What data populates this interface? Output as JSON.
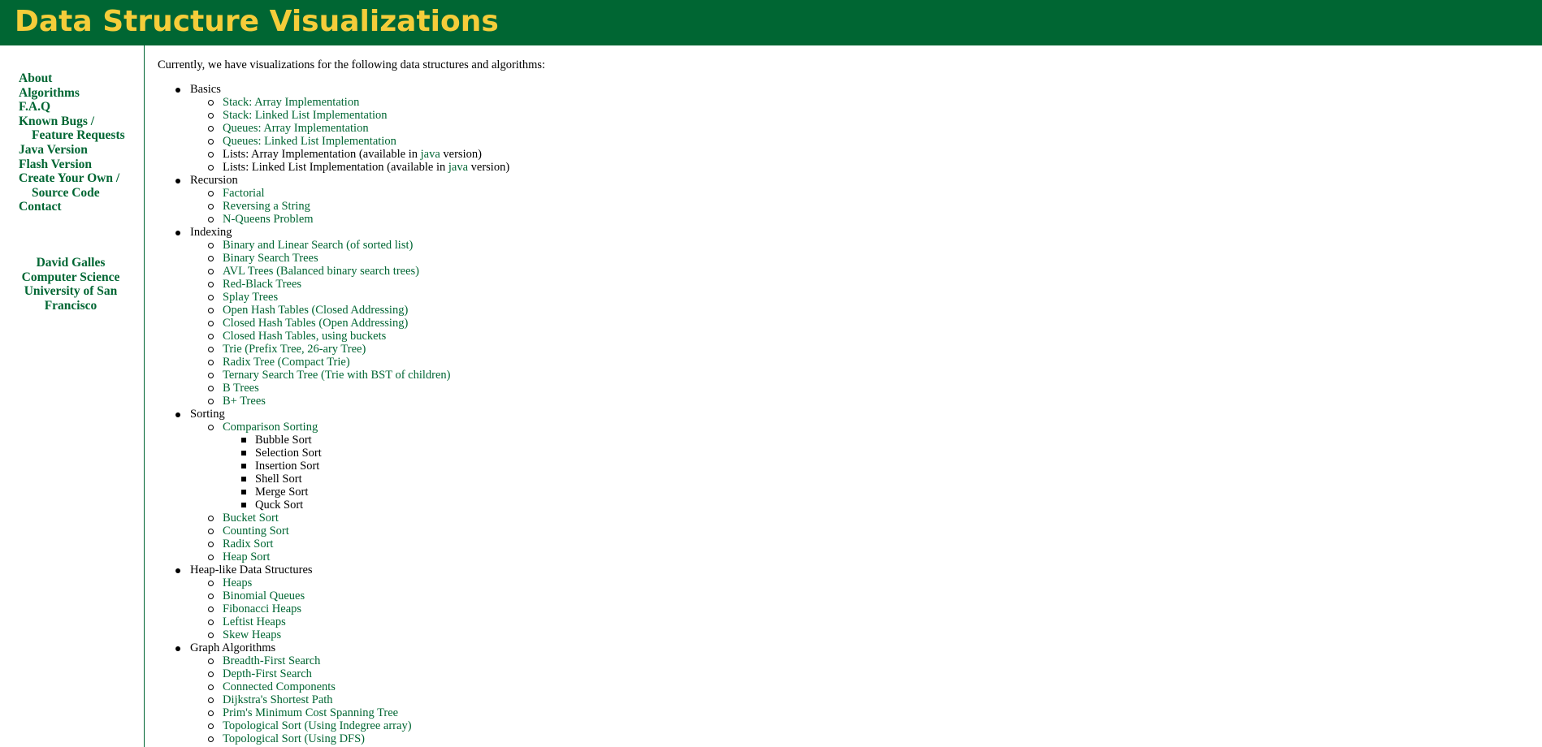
{
  "header": {
    "title": "Data Structure Visualizations"
  },
  "sidebar": {
    "links": [
      {
        "line1": "About",
        "line2": ""
      },
      {
        "line1": "Algorithms",
        "line2": ""
      },
      {
        "line1": "F.A.Q",
        "line2": ""
      },
      {
        "line1": "Known Bugs /",
        "line2": "Feature Requests"
      },
      {
        "line1": "Java Version",
        "line2": ""
      },
      {
        "line1": "Flash Version",
        "line2": ""
      },
      {
        "line1": "Create Your Own /",
        "line2": "Source Code"
      },
      {
        "line1": "Contact",
        "line2": ""
      }
    ],
    "author": {
      "name": "David Galles",
      "dept": "Computer Science",
      "univ_line1": "University of San",
      "univ_line2": "Francisco"
    }
  },
  "content": {
    "intro": "Currently, we have visualizations for the following data structures and algorithms:",
    "sections": [
      {
        "title": "Basics",
        "items": [
          {
            "label": "Stack: Array Implementation"
          },
          {
            "label": "Stack: Linked List Implementation"
          },
          {
            "label": "Queues: Array Implementation"
          },
          {
            "label": "Queues: Linked List Implementation"
          },
          {
            "prefix": "Lists: Array Implementation (available in ",
            "link": "java",
            "suffix": " version)"
          },
          {
            "prefix": "Lists: Linked List Implementation (available in ",
            "link": "java",
            "suffix": " version)"
          }
        ]
      },
      {
        "title": "Recursion",
        "items": [
          {
            "label": "Factorial"
          },
          {
            "label": "Reversing a String"
          },
          {
            "label": "N-Queens Problem"
          }
        ]
      },
      {
        "title": "Indexing",
        "items": [
          {
            "label": "Binary and Linear Search (of sorted list)"
          },
          {
            "label": "Binary Search Trees"
          },
          {
            "label": "AVL Trees (Balanced binary search trees)"
          },
          {
            "label": "Red-Black Trees"
          },
          {
            "label": "Splay Trees"
          },
          {
            "label": "Open Hash Tables (Closed Addressing)"
          },
          {
            "label": "Closed Hash Tables (Open Addressing)"
          },
          {
            "label": "Closed Hash Tables, using buckets"
          },
          {
            "label": "Trie (Prefix Tree, 26-ary Tree)"
          },
          {
            "label": "Radix Tree (Compact Trie)"
          },
          {
            "label": "Ternary Search Tree (Trie with BST of children)"
          },
          {
            "label": "B Trees"
          },
          {
            "label": "B+ Trees"
          }
        ]
      },
      {
        "title": "Sorting",
        "items": [
          {
            "label": "Comparison Sorting",
            "sub": [
              "Bubble Sort",
              "Selection Sort",
              "Insertion Sort",
              "Shell Sort",
              "Merge Sort",
              "Quck Sort"
            ]
          },
          {
            "label": "Bucket Sort"
          },
          {
            "label": "Counting Sort"
          },
          {
            "label": "Radix Sort"
          },
          {
            "label": "Heap Sort"
          }
        ]
      },
      {
        "title": "Heap-like Data Structures",
        "items": [
          {
            "label": "Heaps"
          },
          {
            "label": "Binomial Queues"
          },
          {
            "label": "Fibonacci Heaps"
          },
          {
            "label": "Leftist Heaps"
          },
          {
            "label": "Skew Heaps"
          }
        ]
      },
      {
        "title": "Graph Algorithms",
        "items": [
          {
            "label": "Breadth-First Search"
          },
          {
            "label": "Depth-First Search"
          },
          {
            "label": "Connected Components"
          },
          {
            "label": "Dijkstra's Shortest Path"
          },
          {
            "label": "Prim's Minimum Cost Spanning Tree"
          },
          {
            "label": "Topological Sort (Using Indegree array)"
          },
          {
            "label": "Topological Sort (Using DFS)"
          }
        ]
      }
    ]
  }
}
